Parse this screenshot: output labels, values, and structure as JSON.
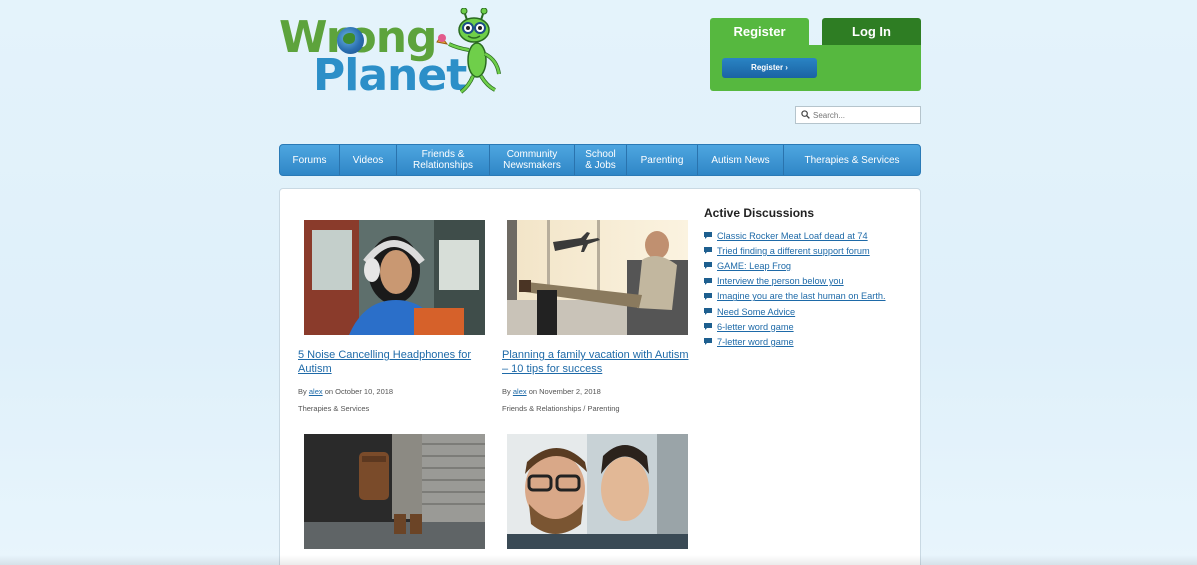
{
  "logo": {
    "line1": "Wrong",
    "line2": "Planet"
  },
  "auth": {
    "register_tab": "Register",
    "login_tab": "Log In",
    "register_button": "Register ›"
  },
  "search": {
    "placeholder": "Search..."
  },
  "nav": {
    "items": [
      {
        "line1": "Forums"
      },
      {
        "line1": "Videos"
      },
      {
        "line1": "Friends &",
        "line2": "Relationships"
      },
      {
        "line1": "Community",
        "line2": "Newsmakers"
      },
      {
        "line1": "School",
        "line2": "& Jobs"
      },
      {
        "line1": "Parenting"
      },
      {
        "line1": "Autism News"
      },
      {
        "line1": "Therapies & Services"
      }
    ]
  },
  "articles": [
    {
      "title": "5 Noise Cancelling Headphones for Autism",
      "by": "By",
      "author": "alex",
      "date": "on October 10, 2018",
      "category": "Therapies & Services",
      "image": "woman-with-headphones"
    },
    {
      "title": "Planning a family vacation with Autism – 10 tips for success",
      "by": "By",
      "author": "alex",
      "date": "on November 2, 2018",
      "category": "Friends & Relationships / Parenting",
      "image": "airport-traveler"
    },
    {
      "image": "person-with-backpack"
    },
    {
      "image": "two-men-selfie"
    }
  ],
  "sidebar": {
    "title": "Active Discussions",
    "items": [
      "Classic Rocker Meat Loaf dead at 74",
      "Tried finding a different support forum",
      "GAME: Leap Frog",
      "Interview the person below you",
      "Imagine you are the last human on Earth.",
      "Need Some Advice",
      "6-letter word game",
      "7-letter word game"
    ]
  },
  "colors": {
    "accent_green": "#56b83f",
    "dark_green": "#2e7d23",
    "nav_blue": "#2f86c6",
    "link_blue": "#1e6aa8"
  }
}
